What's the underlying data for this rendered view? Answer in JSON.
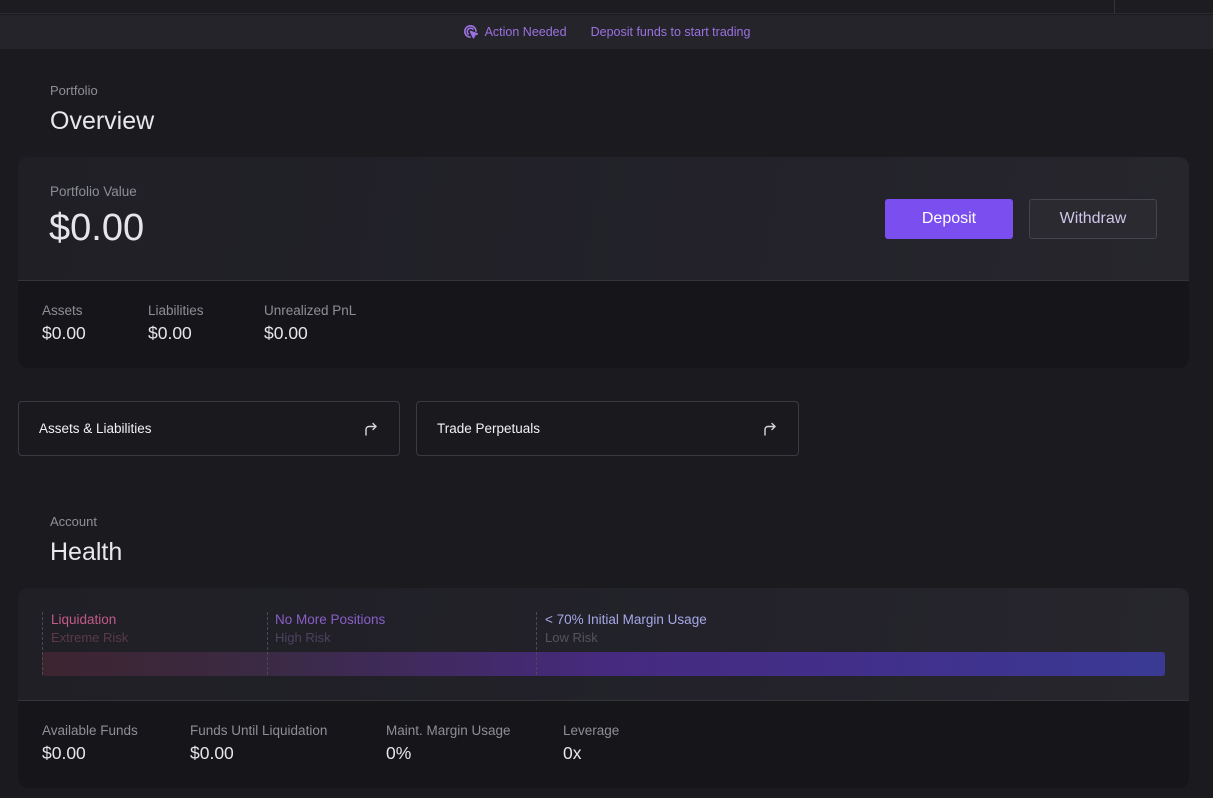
{
  "banner": {
    "action_label": "Action Needed",
    "message": "Deposit funds to start trading"
  },
  "overview": {
    "section_label": "Portfolio",
    "title": "Overview",
    "portfolio_value_label": "Portfolio Value",
    "portfolio_value": "$0.00",
    "deposit_label": "Deposit",
    "withdraw_label": "Withdraw",
    "stats": [
      {
        "label": "Assets",
        "value": "$0.00"
      },
      {
        "label": "Liabilities",
        "value": "$0.00"
      },
      {
        "label": "Unrealized PnL",
        "value": "$0.00"
      }
    ]
  },
  "links": [
    {
      "label": "Assets & Liabilities"
    },
    {
      "label": "Trade Perpetuals"
    }
  ],
  "health": {
    "section_label": "Account",
    "title": "Health",
    "markers": [
      {
        "title": "Liquidation",
        "subtitle": "Extreme Risk",
        "color": "#c25a8c"
      },
      {
        "title": "No More Positions",
        "subtitle": "High Risk",
        "color": "#8a5ec8"
      },
      {
        "title": "< 70% Initial Margin Usage",
        "subtitle": "Low Risk",
        "color": "#a7a7e8"
      }
    ],
    "stats": [
      {
        "label": "Available Funds",
        "value": "$0.00"
      },
      {
        "label": "Funds Until Liquidation",
        "value": "$0.00"
      },
      {
        "label": "Maint. Margin Usage",
        "value": "0%"
      },
      {
        "label": "Leverage",
        "value": "0x"
      }
    ]
  },
  "colors": {
    "accent": "#7b4ef0",
    "banner_text": "#9b72e0"
  }
}
